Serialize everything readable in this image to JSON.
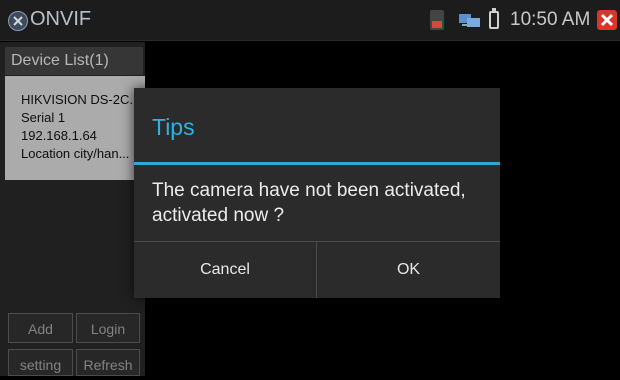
{
  "app": {
    "title": "ONVIF",
    "time": "10:50 AM"
  },
  "sidebar": {
    "header": "Device List(1)",
    "devices": [
      {
        "name": "HIKVISION DS-2C...",
        "serial": "Serial  1",
        "ip": "192.168.1.64",
        "location": "Location  city/han..."
      }
    ],
    "buttons": {
      "add": "Add",
      "login": "Login",
      "setting": "setting",
      "refresh": "Refresh"
    }
  },
  "dialog": {
    "title": "Tips",
    "message": "The camera have not been activated, activated now ?",
    "cancel": "Cancel",
    "ok": "OK"
  },
  "colors": {
    "accent": "#2fb1e2",
    "close": "#d9362b"
  }
}
